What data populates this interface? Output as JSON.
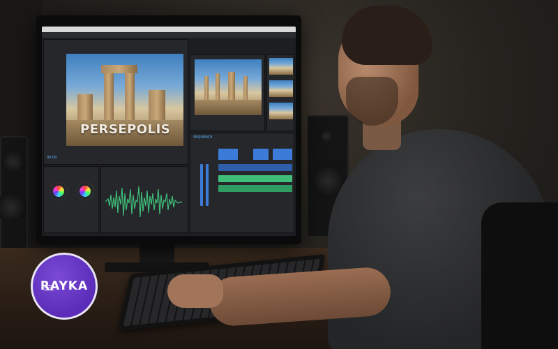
{
  "scene": {
    "video_title_overlay": "PERSEPOLIS",
    "brand_logo_text": "RAYKA"
  },
  "colors": {
    "logo_purple": "#5a2cb8",
    "timeline_blue": "#3d7bd8",
    "audio_green": "#3fbf7a",
    "ui_accent": "#58b7ff"
  },
  "icons": [
    "color-wheel-icon",
    "waveform-icon",
    "play-icon"
  ]
}
